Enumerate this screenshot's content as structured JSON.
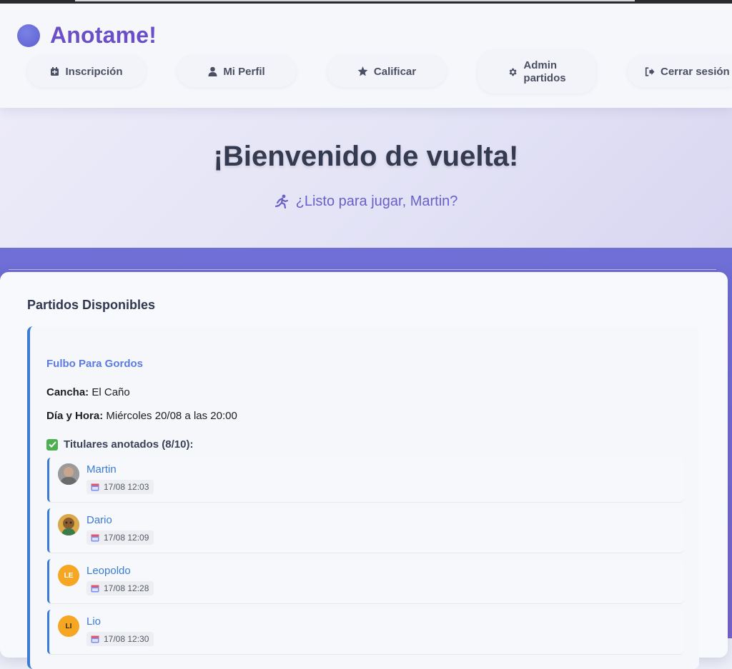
{
  "app": {
    "name": "Anotame!"
  },
  "nav": [
    {
      "label": "Inscripción",
      "icon": "calendar-icon"
    },
    {
      "label": "Mi Perfil",
      "icon": "user-icon"
    },
    {
      "label": "Calificar",
      "icon": "star-icon"
    },
    {
      "label": "Admin partidos",
      "line1": "Admin",
      "line2": "partidos",
      "icon": "gear-icon"
    },
    {
      "label": "Cerrar sesión",
      "icon": "logout-icon"
    }
  ],
  "hero": {
    "title": "¡Bienvenido de vuelta!",
    "subtitle": "¿Listo para jugar, Martin?"
  },
  "panel": {
    "title": "Partidos Disponibles",
    "match": {
      "name": "Fulbo Para Gordos",
      "cancha_label": "Cancha:",
      "cancha": "El Caño",
      "datetime_label": "Día y Hora:",
      "datetime": "Miércoles 20/08 a las 20:00",
      "titulares_label": "Titulares anotados (8/10):",
      "players": [
        {
          "name": "Martin",
          "date": "17/08 12:03",
          "initials": ""
        },
        {
          "name": "Dario",
          "date": "17/08 12:09",
          "initials": ""
        },
        {
          "name": "Leopoldo",
          "date": "17/08 12:28",
          "initials": "LE"
        },
        {
          "name": "Lio",
          "date": "17/08 12:30",
          "initials": "LI"
        }
      ]
    }
  },
  "colors": {
    "brand": "#6a4fc6",
    "accent": "#3a7bd5",
    "avatar_initials_bg": "#f5a623"
  }
}
